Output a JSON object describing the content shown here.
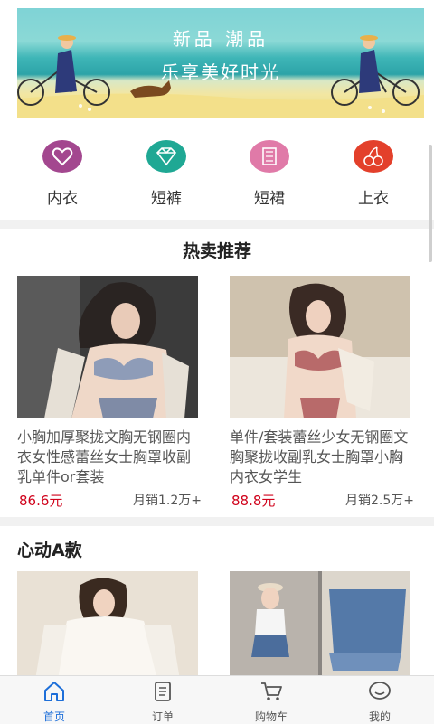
{
  "banner": {
    "line1": "新品  潮品",
    "line2": "乐享美好时光"
  },
  "categories": [
    {
      "label": "内衣",
      "icon": "heart-icon",
      "color": "#a3478f"
    },
    {
      "label": "短裤",
      "icon": "diamond-icon",
      "color": "#1fa894"
    },
    {
      "label": "短裙",
      "icon": "skirt-icon",
      "color": "#e07aa8"
    },
    {
      "label": "上衣",
      "icon": "cherry-icon",
      "color": "#e3402b"
    }
  ],
  "hot": {
    "title": "热卖推荐",
    "products": [
      {
        "name": "小胸加厚聚拢文胸无钢圈内衣女性感蕾丝女士胸罩收副乳单件or套装",
        "price": "86.6元",
        "sales": "月销1.2万+"
      },
      {
        "name": "单件/套装蕾丝少女无钢圈文胸聚拢收副乳女士胸罩小胸内衣女学生",
        "price": "88.8元",
        "sales": "月销2.5万+"
      }
    ]
  },
  "section_a": {
    "title": "心动A款"
  },
  "tabbar": [
    {
      "label": "首页",
      "icon": "home-icon",
      "active": true
    },
    {
      "label": "订单",
      "icon": "order-icon",
      "active": false
    },
    {
      "label": "购物车",
      "icon": "cart-icon",
      "active": false
    },
    {
      "label": "我的",
      "icon": "profile-icon",
      "active": false
    }
  ],
  "colors": {
    "accent": "#1e6fd9",
    "price": "#d0021b"
  }
}
